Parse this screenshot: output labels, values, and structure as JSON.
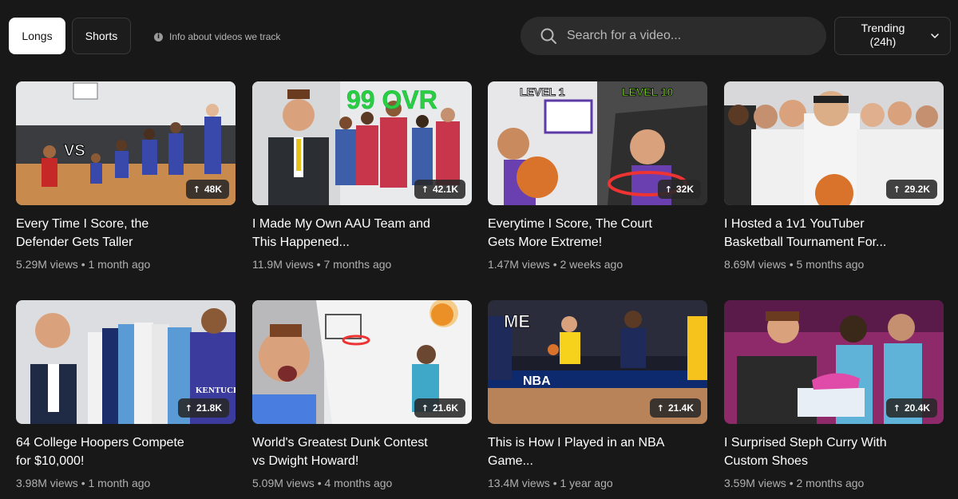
{
  "tabs": [
    {
      "label": "Longs",
      "active": true
    },
    {
      "label": "Shorts",
      "active": false
    }
  ],
  "info": {
    "icon": "info-icon",
    "text": "Info about videos we track"
  },
  "search": {
    "icon": "search-icon",
    "placeholder": "Search for a video..."
  },
  "sort": {
    "line1": "Trending",
    "line2": "(24h)",
    "icon": "chevron-down-icon"
  },
  "videos": [
    {
      "title_line1": "Every Time I Score, the",
      "title_line2": "Defender Gets Taller",
      "views": "5.29M views",
      "age": "1 month ago",
      "badge": "48K",
      "thumb_text": "VS"
    },
    {
      "title_line1": "I Made My Own AAU Team and",
      "title_line2": "This Happened...",
      "views": "11.9M views",
      "age": "7 months ago",
      "badge": "42.1K",
      "thumb_text": "99 OVR"
    },
    {
      "title_line1": "Everytime I Score, The Court",
      "title_line2": "Gets More Extreme!",
      "views": "1.47M views",
      "age": "2 weeks ago",
      "badge": "32K",
      "thumb_text": "LEVEL 1",
      "thumb_text2": "LEVEL 10"
    },
    {
      "title_line1": "I Hosted a 1v1 YouTuber",
      "title_line2": "Basketball Tournament For...",
      "views": "8.69M views",
      "age": "5 months ago",
      "badge": "29.2K"
    },
    {
      "title_line1": "64 College Hoopers Compete",
      "title_line2": "for $10,000!",
      "views": "3.98M views",
      "age": "1 month ago",
      "badge": "21.8K",
      "thumb_text": "KENTUCKY"
    },
    {
      "title_line1": "World's Greatest Dunk Contest",
      "title_line2": "vs Dwight Howard!",
      "views": "5.09M views",
      "age": "4 months ago",
      "badge": "21.6K"
    },
    {
      "title_line1": "This is How I Played in an NBA",
      "title_line2": "Game...",
      "views": "13.4M views",
      "age": "1 year ago",
      "badge": "21.4K",
      "thumb_text": "ME",
      "thumb_text2": "NBA"
    },
    {
      "title_line1": "I Surprised Steph Curry With",
      "title_line2": "Custom Shoes",
      "views": "3.59M views",
      "age": "2 months ago",
      "badge": "20.4K"
    }
  ],
  "colors": {
    "background": "#181818",
    "search_bg": "#2c2c2c",
    "meta_text": "#b0b0b0"
  }
}
